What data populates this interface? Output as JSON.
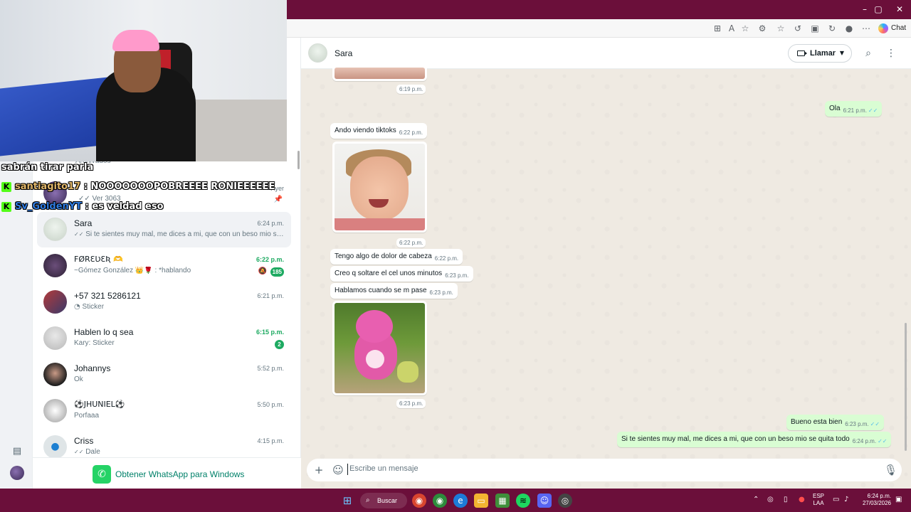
{
  "browser": {
    "chat_label": "Chat",
    "controls": {
      "minimize": "–",
      "maximize": "▢",
      "close": "✕"
    }
  },
  "overlay": {
    "line0": "sabrán tirar parla",
    "line1_user": "santiagito17",
    "line1_text": " : NOOOOOOOPOBREEEE RONIEEEEEE",
    "line2_user": "Sv_GoldenYT",
    "line2_text": " : es veldad eso"
  },
  "chat_list": {
    "archived_hint": "Archivados",
    "items": [
      {
        "name": "",
        "preview": "Ver 3063",
        "time": "Ayer",
        "pinned": true
      },
      {
        "name": "Sara",
        "preview": "Si te sientes muy mal, me dices a mi, que con un beso mio se quit...",
        "time": "6:24 p.m."
      },
      {
        "name": "FØRƐƲƐƦ 🫶",
        "preview": "~Gómez González 👑🌹 : *hablando",
        "time": "6:22 p.m.",
        "badge": "185"
      },
      {
        "name": "+57 321 5286121",
        "preview": "Sticker",
        "time": "6:21 p.m."
      },
      {
        "name": "Hablen lo q sea",
        "preview": "Kary: Sticker",
        "time": "6:15 p.m.",
        "badge": "2"
      },
      {
        "name": "Johannys",
        "preview": "Ok",
        "time": "5:52 p.m."
      },
      {
        "name": "⚽JHUNIEL⚽",
        "preview": "Porfaaa",
        "time": "5:50 p.m."
      },
      {
        "name": "Criss",
        "preview": "Dale",
        "time": "4:15 p.m."
      }
    ],
    "get_app": "Obtener WhatsApp para Windows"
  },
  "conversation": {
    "contact": "Sara",
    "call_label": "Llamar",
    "messages": {
      "m0_time": "6:19 p.m.",
      "m1_text": "Ola",
      "m1_time": "6:21 p.m.",
      "m2_text": "Ando viendo tiktoks",
      "m2_time": "6:22 p.m.",
      "m3_time": "6:22 p.m.",
      "m4_text": "Tengo algo de dolor de cabeza",
      "m4_time": "6:22 p.m.",
      "m5_text": "Creo q soltare el cel unos minutos",
      "m5_time": "6:23 p.m.",
      "m6_text": "Hablamos cuando se m pase",
      "m6_time": "6:23 p.m.",
      "m7_time": "6:23 p.m.",
      "m8_text": "Bueno esta bien",
      "m8_time": "6:23 p.m.",
      "m9_text": "Si te sientes muy mal, me dices a mi, que con un beso mio se quita todo",
      "m9_time": "6:24 p.m."
    },
    "composer_placeholder": "Escribe un mensaje"
  },
  "taskbar": {
    "search_label": "Buscar",
    "lang": "ESP",
    "lang2": "LAA",
    "time": "6:24 p.m.",
    "date": "27/03/2026"
  }
}
